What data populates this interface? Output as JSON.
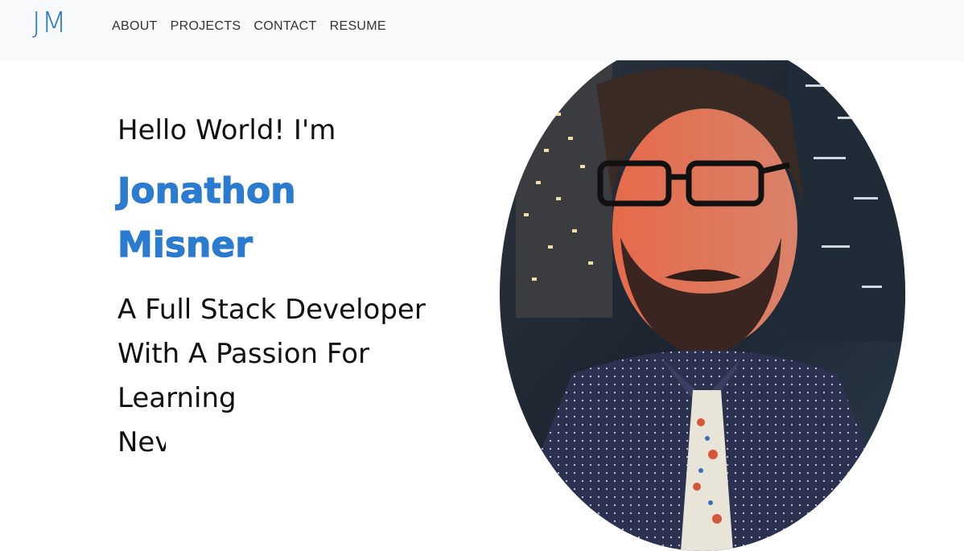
{
  "nav": {
    "brand": "JM",
    "links": [
      "ABOUT",
      "PROJECTS",
      "CONTACT",
      "RESUME"
    ]
  },
  "hero": {
    "greeting": "Hello World! I'm",
    "name_first": "Jonathon",
    "name_last": "Misner",
    "tagline": "A Full Stack Developer With A Passion For Learning",
    "typed_text": "Nev"
  },
  "colors": {
    "accent": "#2b7bd0",
    "nav_bg": "#f8f9fa",
    "text": "#111111"
  },
  "portrait": {
    "icon": "profile-photo"
  }
}
